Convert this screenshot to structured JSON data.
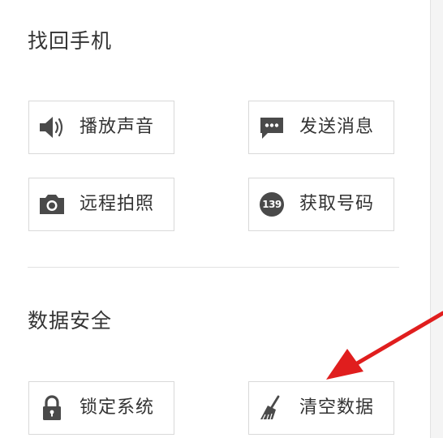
{
  "sections": {
    "find_phone": {
      "title": "找回手机",
      "actions": {
        "play_sound": {
          "label": "播放声音",
          "icon": "speaker-icon"
        },
        "send_message": {
          "label": "发送消息",
          "icon": "message-icon"
        },
        "remote_photo": {
          "label": "远程拍照",
          "icon": "camera-icon"
        },
        "get_number": {
          "label": "获取号码",
          "icon": "number-139-icon",
          "badge_text": "139"
        }
      }
    },
    "data_security": {
      "title": "数据安全",
      "actions": {
        "lock_system": {
          "label": "锁定系统",
          "icon": "lock-icon"
        },
        "clear_data": {
          "label": "清空数据",
          "icon": "broom-icon"
        }
      }
    }
  },
  "colors": {
    "icon": "#4a4a4a",
    "annotation_arrow": "#e01e1e",
    "border": "#d9d9d9",
    "text": "#333333"
  }
}
